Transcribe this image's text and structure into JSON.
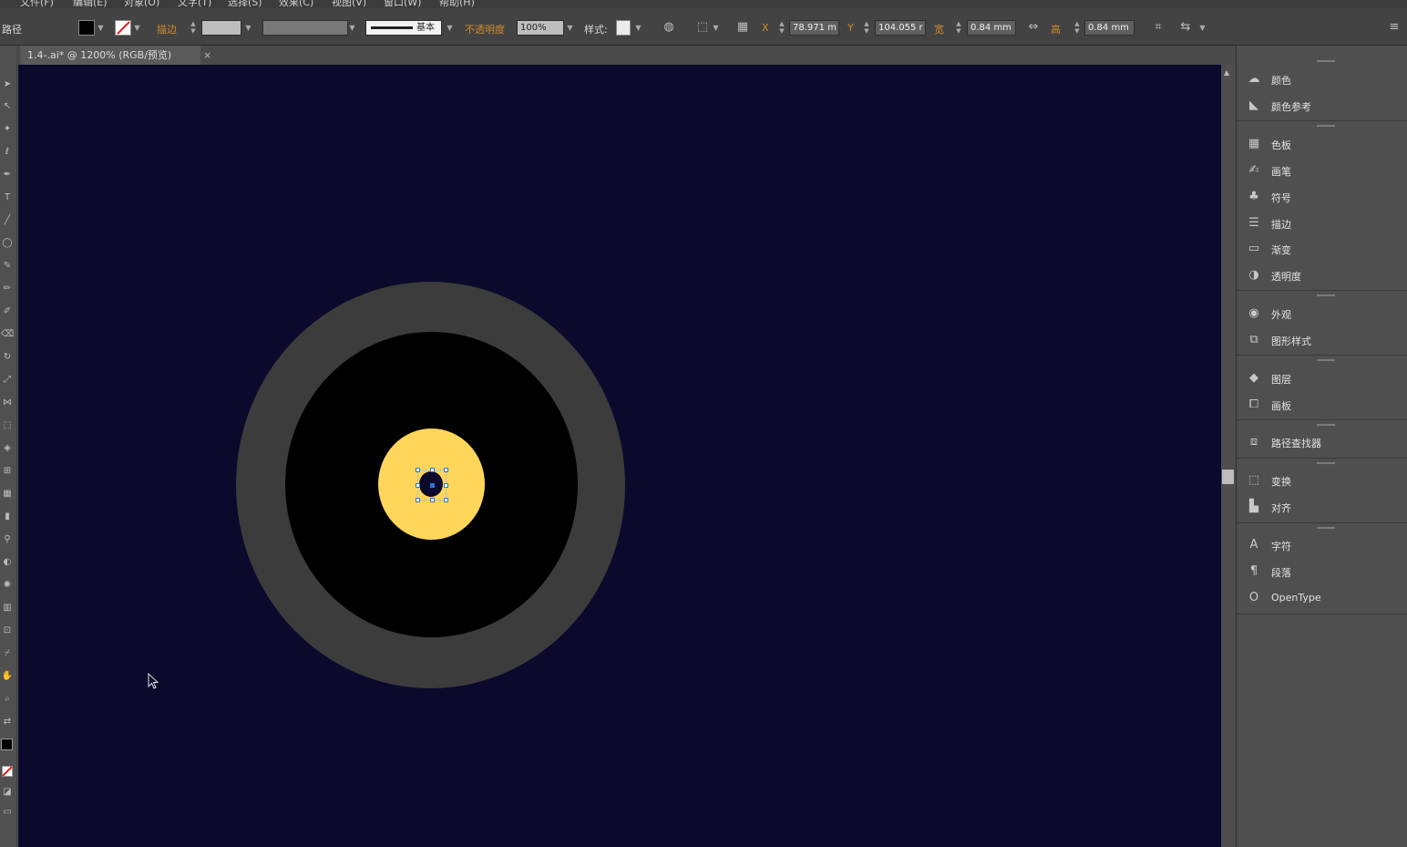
{
  "menubar": {
    "items": [
      "文件(F)",
      "编辑(E)",
      "对象(O)",
      "文字(T)",
      "选择(S)",
      "效果(C)",
      "视图(V)",
      "窗口(W)",
      "帮助(H)"
    ]
  },
  "controlbar": {
    "object_label": "路径",
    "stroke_label": "描边",
    "stroke_profile": "基本",
    "opacity_label": "不透明度",
    "opacity_value": "100%",
    "style_label": "样式:",
    "x_label": "X",
    "x_value": "78.971 m",
    "y_label": "Y",
    "y_value": "104.055 r",
    "w_label": "宽",
    "w_value": "0.84 mm",
    "h_label": "高",
    "h_value": "0.84 mm"
  },
  "document_tab": {
    "title": "1.4-.ai* @ 1200% (RGB/预览)",
    "close": "×"
  },
  "canvas": {
    "background": "#0b0a2c",
    "ring_outer_color": "#3c3c3c",
    "ring_inner_color": "#000000",
    "sun_color": "#ffd65a",
    "dot_color": "#0b0a2c"
  },
  "panels": {
    "group1": [
      "颜色",
      "颜色参考"
    ],
    "group2": [
      "色板",
      "画笔",
      "符号",
      "描边",
      "渐变",
      "透明度"
    ],
    "group3": [
      "外观",
      "图形样式"
    ],
    "group4": [
      "图层",
      "画板"
    ],
    "group5": [
      "路径查找器"
    ],
    "group6": [
      "变换",
      "对齐"
    ],
    "group7": [
      "字符",
      "段落",
      "OpenType"
    ]
  },
  "icons": {
    "panel_icons": [
      "color-icon",
      "color-guide-icon",
      "swatches-icon",
      "brushes-icon",
      "symbols-icon",
      "stroke-icon",
      "gradient-icon",
      "transparency-icon",
      "appearance-icon",
      "graphic-styles-icon",
      "layers-icon",
      "artboards-icon",
      "pathfinder-icon",
      "transform-icon",
      "align-icon",
      "character-icon",
      "paragraph-icon",
      "opentype-icon"
    ]
  }
}
